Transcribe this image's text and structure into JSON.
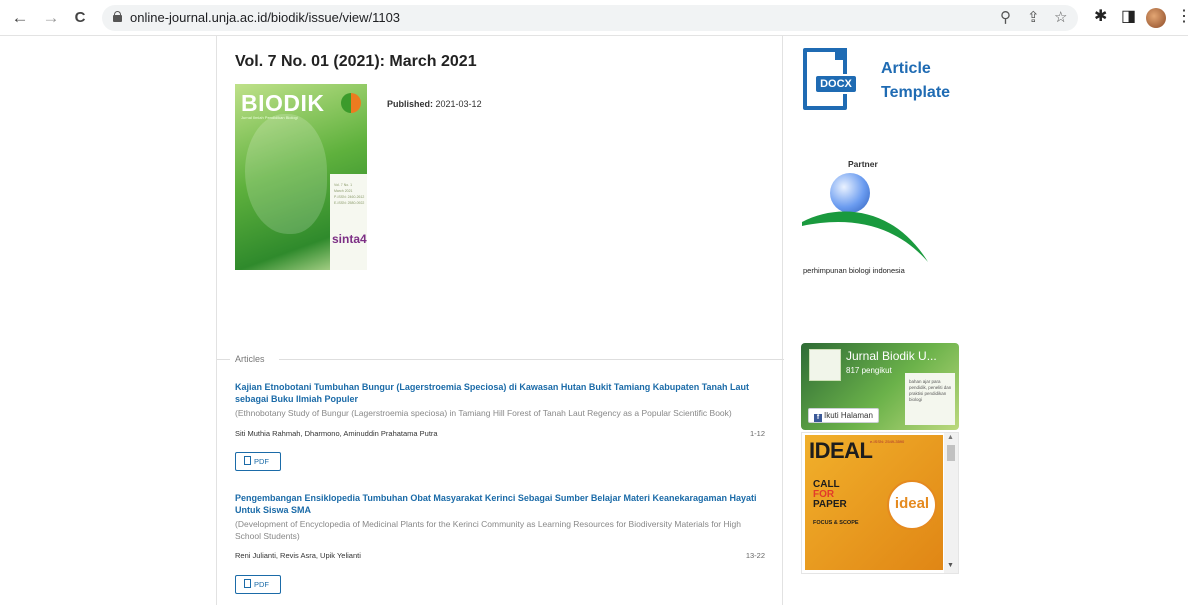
{
  "browser": {
    "url": "online-journal.unja.ac.id/biodik/issue/view/1103",
    "back_glyph": "←",
    "forward_glyph": "→",
    "reload_glyph": "C",
    "zoom_glyph": "⚲",
    "share_glyph": "⇪",
    "bookmark_glyph": "☆",
    "extensions_glyph": "✱",
    "sidepanel_glyph": "◨",
    "menu_glyph": "⋮"
  },
  "issue": {
    "title": "Vol. 7 No. 01 (2021): March 2021",
    "published_label": "Published:",
    "published_date": "2021-03-12",
    "cover": {
      "title": "BIODIK",
      "subtitle": "Jurnal Ilmiah Pendidikan Biologi",
      "vol_line": "Vol. 7 No. 1",
      "month_line": "March 2021",
      "issn_line1": "P-ISSN: 2460-2612",
      "issn_line2": "E-ISSN: 2580-0922",
      "sinta": "sinta4"
    }
  },
  "articles": {
    "legend": "Articles",
    "items": [
      {
        "title": "Kajian Etnobotani Tumbuhan Bungur (Lagerstroemia Speciosa) di Kawasan Hutan Bukit Tamiang Kabupaten Tanah Laut sebagai Buku Ilmiah Populer",
        "subtitle": "(Ethnobotany Study of Bungur (Lagerstroemia speciosa) in Tamiang Hill Forest of Tanah Laut Regency as a Popular Scientific Book)",
        "authors": "Siti Muthia Rahmah, Dharmono, Aminuddin Prahatama Putra",
        "pages": "1-12",
        "pdf_label": "PDF"
      },
      {
        "title": "Pengembangan Ensiklopedia Tumbuhan Obat Masyarakat Kerinci Sebagai Sumber Belajar Materi Keanekaragaman Hayati Untuk Siswa SMA",
        "subtitle": "(Development of Encyclopedia of Medicinal Plants for the Kerinci Community as Learning Resources for Biodiversity Materials for High School Students)",
        "authors": "Reni Julianti, Revis Asra, Upik Yelianti",
        "pages": "13-22",
        "pdf_label": "PDF"
      }
    ]
  },
  "sidebar": {
    "template": {
      "badge": "DOCX",
      "line1": "Article",
      "line2": "Template"
    },
    "partner": {
      "label": "Partner",
      "org_name": "perhimpunan biologi indonesia"
    },
    "facebook": {
      "page_name": "Jurnal Biodik U...",
      "followers": "817 pengikut",
      "follow_label": "Ikuti Halaman",
      "logo_glyph": "f",
      "card_text": "bahan ajar para pendidik, peneliti dan praktisi pendidikan biologi"
    },
    "promo": {
      "brand": "IDEAL",
      "call": "CALL",
      "for": "FOR",
      "paper": "PAPER",
      "focus": "FOCUS & SCOPE",
      "logo_text": "ideal",
      "issn": "e-ISSN: 2549-3590"
    }
  },
  "colors": {
    "link": "#1b6ba8",
    "accent": "#1f6bb3"
  }
}
